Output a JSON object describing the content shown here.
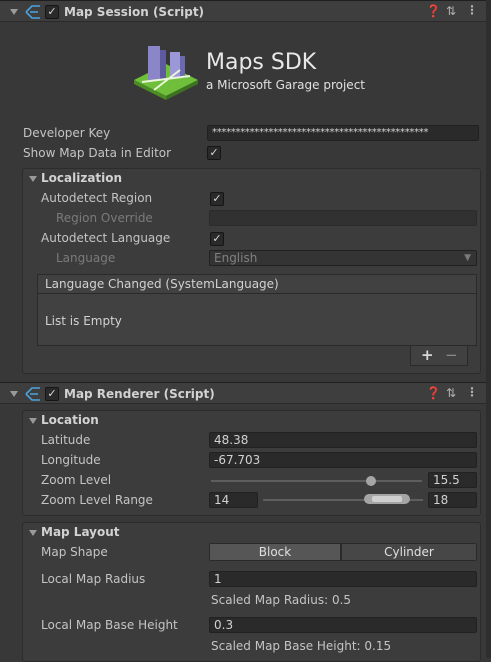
{
  "map_session": {
    "title": "Map Session (Script)",
    "logo_title": "Maps SDK",
    "logo_subtitle": "a Microsoft Garage project",
    "developer_key_label": "Developer Key",
    "developer_key_value": "**********************************************",
    "show_map_data_label": "Show Map Data in Editor",
    "show_map_data_checked": true,
    "localization": {
      "title": "Localization",
      "autodetect_region_label": "Autodetect Region",
      "autodetect_region_checked": true,
      "region_override_label": "Region Override",
      "region_override_value": "",
      "autodetect_language_label": "Autodetect Language",
      "autodetect_language_checked": true,
      "language_label": "Language",
      "language_value": "English",
      "event_title": "Language Changed (SystemLanguage)",
      "event_empty": "List is Empty",
      "add_label": "+",
      "remove_label": "−"
    }
  },
  "map_renderer": {
    "title": "Map Renderer (Script)",
    "location": {
      "title": "Location",
      "latitude_label": "Latitude",
      "latitude_value": "48.38",
      "longitude_label": "Longitude",
      "longitude_value": "-67.703",
      "zoom_label": "Zoom Level",
      "zoom_value": "15.5",
      "zoom_range_label": "Zoom Level Range",
      "zoom_range_min": "14",
      "zoom_range_max": "18"
    },
    "map_layout": {
      "title": "Map Layout",
      "shape_label": "Map Shape",
      "shape_options": [
        "Block",
        "Cylinder"
      ],
      "shape_selected": "Block",
      "radius_label": "Local Map Radius",
      "radius_value": "1",
      "scaled_radius_text": "Scaled Map Radius: 0.5",
      "base_height_label": "Local Map Base Height",
      "base_height_value": "0.3",
      "scaled_base_height_text": "Scaled Map Base Height: 0.15"
    }
  },
  "colors": {
    "background": "#383838",
    "header": "#3e3e3e",
    "field": "#2a2a2a",
    "text": "#c4c4c4",
    "logo_green": "#6fbf3a",
    "logo_purple": "#8a86c8"
  },
  "icons": [
    "help-icon",
    "preset-icon",
    "menu-icon",
    "script-icon",
    "checkmark-icon",
    "dropdown-arrow-icon",
    "foldout-arrow-icon"
  ]
}
